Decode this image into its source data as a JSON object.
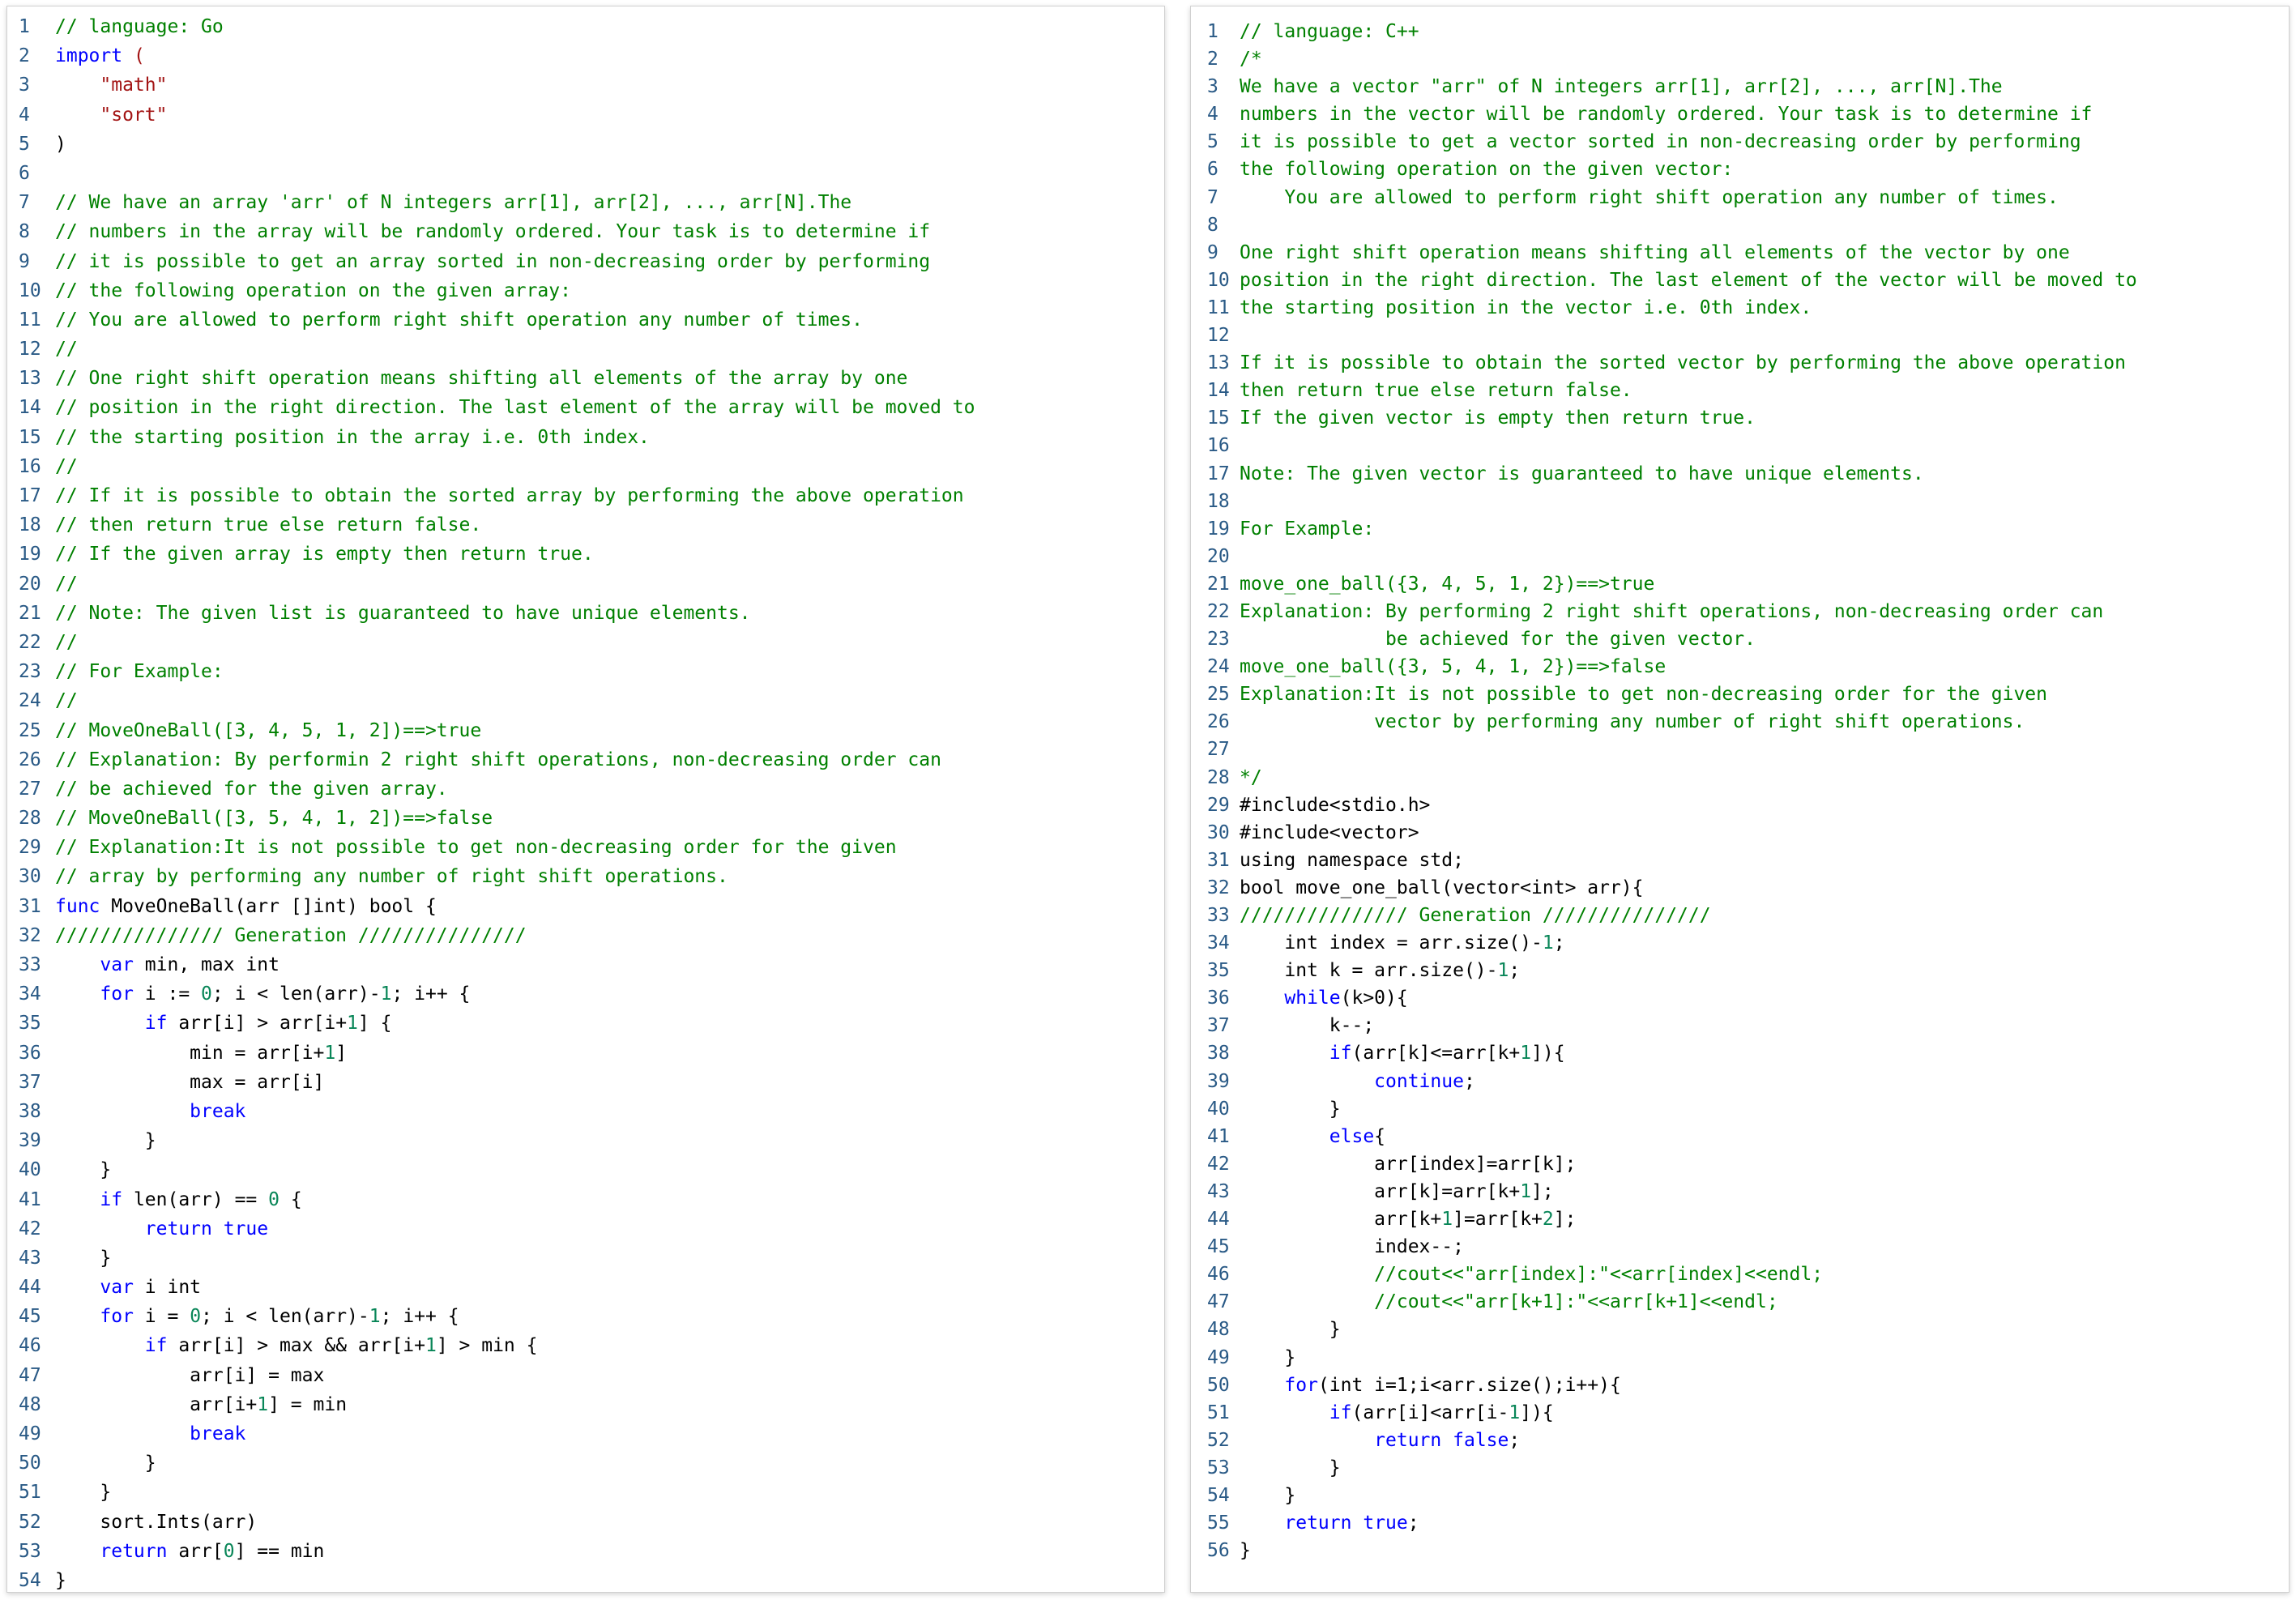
{
  "panels": [
    {
      "id": "left",
      "lines": [
        [
          [
            "c",
            "// language: Go"
          ]
        ],
        [
          [
            "k",
            "import"
          ],
          [
            "t",
            " "
          ],
          [
            "s",
            "("
          ]
        ],
        [
          [
            "t",
            "    "
          ],
          [
            "s",
            "\"math\""
          ]
        ],
        [
          [
            "t",
            "    "
          ],
          [
            "s",
            "\"sort\""
          ]
        ],
        [
          [
            "t",
            ")"
          ]
        ],
        [],
        [
          [
            "c",
            "// We have an array 'arr' of N integers arr[1], arr[2], ..., arr[N].The"
          ]
        ],
        [
          [
            "c",
            "// numbers in the array will be randomly ordered. Your task is to determine if"
          ]
        ],
        [
          [
            "c",
            "// it is possible to get an array sorted in non-decreasing order by performing"
          ]
        ],
        [
          [
            "c",
            "// the following operation on the given array:"
          ]
        ],
        [
          [
            "c",
            "// You are allowed to perform right shift operation any number of times."
          ]
        ],
        [
          [
            "c",
            "//"
          ]
        ],
        [
          [
            "c",
            "// One right shift operation means shifting all elements of the array by one"
          ]
        ],
        [
          [
            "c",
            "// position in the right direction. The last element of the array will be moved to"
          ]
        ],
        [
          [
            "c",
            "// the starting position in the array i.e. 0th index."
          ]
        ],
        [
          [
            "c",
            "//"
          ]
        ],
        [
          [
            "c",
            "// If it is possible to obtain the sorted array by performing the above operation"
          ]
        ],
        [
          [
            "c",
            "// then return true else return false."
          ]
        ],
        [
          [
            "c",
            "// If the given array is empty then return true."
          ]
        ],
        [
          [
            "c",
            "//"
          ]
        ],
        [
          [
            "c",
            "// Note: The given list is guaranteed to have unique elements."
          ]
        ],
        [
          [
            "c",
            "//"
          ]
        ],
        [
          [
            "c",
            "// For Example:"
          ]
        ],
        [
          [
            "c",
            "//"
          ]
        ],
        [
          [
            "c",
            "// MoveOneBall([3, 4, 5, 1, 2])==>true"
          ]
        ],
        [
          [
            "c",
            "// Explanation: By performin 2 right shift operations, non-decreasing order can"
          ]
        ],
        [
          [
            "c",
            "// be achieved for the given array."
          ]
        ],
        [
          [
            "c",
            "// MoveOneBall([3, 5, 4, 1, 2])==>false"
          ]
        ],
        [
          [
            "c",
            "// Explanation:It is not possible to get non-decreasing order for the given"
          ]
        ],
        [
          [
            "c",
            "// array by performing any number of right shift operations."
          ]
        ],
        [
          [
            "k",
            "func"
          ],
          [
            "t",
            " MoveOneBall(arr []int) bool {"
          ]
        ],
        [
          [
            "c",
            "/////////////// Generation ///////////////"
          ]
        ],
        [
          [
            "t",
            "    "
          ],
          [
            "k",
            "var"
          ],
          [
            "t",
            " min, max int"
          ]
        ],
        [
          [
            "t",
            "    "
          ],
          [
            "k",
            "for"
          ],
          [
            "t",
            " i := "
          ],
          [
            "n",
            "0"
          ],
          [
            "t",
            "; i < len(arr)-"
          ],
          [
            "n",
            "1"
          ],
          [
            "t",
            "; i++ {"
          ]
        ],
        [
          [
            "t",
            "        "
          ],
          [
            "k",
            "if"
          ],
          [
            "t",
            " arr[i] > arr[i+"
          ],
          [
            "n",
            "1"
          ],
          [
            "t",
            "] {"
          ]
        ],
        [
          [
            "t",
            "            min = arr[i+"
          ],
          [
            "n",
            "1"
          ],
          [
            "t",
            "]"
          ]
        ],
        [
          [
            "t",
            "            max = arr[i]"
          ]
        ],
        [
          [
            "t",
            "            "
          ],
          [
            "k",
            "break"
          ]
        ],
        [
          [
            "t",
            "        }"
          ]
        ],
        [
          [
            "t",
            "    }"
          ]
        ],
        [
          [
            "t",
            "    "
          ],
          [
            "k",
            "if"
          ],
          [
            "t",
            " len(arr) == "
          ],
          [
            "n",
            "0"
          ],
          [
            "t",
            " {"
          ]
        ],
        [
          [
            "t",
            "        "
          ],
          [
            "k",
            "return"
          ],
          [
            "t",
            " "
          ],
          [
            "k",
            "true"
          ]
        ],
        [
          [
            "t",
            "    }"
          ]
        ],
        [
          [
            "t",
            "    "
          ],
          [
            "k",
            "var"
          ],
          [
            "t",
            " i int"
          ]
        ],
        [
          [
            "t",
            "    "
          ],
          [
            "k",
            "for"
          ],
          [
            "t",
            " i = "
          ],
          [
            "n",
            "0"
          ],
          [
            "t",
            "; i < len(arr)-"
          ],
          [
            "n",
            "1"
          ],
          [
            "t",
            "; i++ {"
          ]
        ],
        [
          [
            "t",
            "        "
          ],
          [
            "k",
            "if"
          ],
          [
            "t",
            " arr[i] > max && arr[i+"
          ],
          [
            "n",
            "1"
          ],
          [
            "t",
            "] > min {"
          ]
        ],
        [
          [
            "t",
            "            arr[i] = max"
          ]
        ],
        [
          [
            "t",
            "            arr[i+"
          ],
          [
            "n",
            "1"
          ],
          [
            "t",
            "] = min"
          ]
        ],
        [
          [
            "t",
            "            "
          ],
          [
            "k",
            "break"
          ]
        ],
        [
          [
            "t",
            "        }"
          ]
        ],
        [
          [
            "t",
            "    }"
          ]
        ],
        [
          [
            "t",
            "    sort.Ints(arr)"
          ]
        ],
        [
          [
            "t",
            "    "
          ],
          [
            "k",
            "return"
          ],
          [
            "t",
            " arr["
          ],
          [
            "n",
            "0"
          ],
          [
            "t",
            "] == min"
          ]
        ],
        [
          [
            "t",
            "}"
          ]
        ]
      ]
    },
    {
      "id": "right",
      "lines": [
        [
          [
            "c",
            "// language: C++"
          ]
        ],
        [
          [
            "c",
            "/*"
          ]
        ],
        [
          [
            "c",
            "We have a vector \"arr\" of N integers arr[1], arr[2], ..., arr[N].The"
          ]
        ],
        [
          [
            "c",
            "numbers in the vector will be randomly ordered. Your task is to determine if"
          ]
        ],
        [
          [
            "c",
            "it is possible to get a vector sorted in non-decreasing order by performing"
          ]
        ],
        [
          [
            "c",
            "the following operation on the given vector:"
          ]
        ],
        [
          [
            "c",
            "    You are allowed to perform right shift operation any number of times."
          ]
        ],
        [],
        [
          [
            "c",
            "One right shift operation means shifting all elements of the vector by one"
          ]
        ],
        [
          [
            "c",
            "position in the right direction. The last element of the vector will be moved to"
          ]
        ],
        [
          [
            "c",
            "the starting position in the vector i.e. 0th index."
          ]
        ],
        [],
        [
          [
            "c",
            "If it is possible to obtain the sorted vector by performing the above operation"
          ]
        ],
        [
          [
            "c",
            "then return true else return false."
          ]
        ],
        [
          [
            "c",
            "If the given vector is empty then return true."
          ]
        ],
        [],
        [
          [
            "c",
            "Note: The given vector is guaranteed to have unique elements."
          ]
        ],
        [],
        [
          [
            "c",
            "For Example:"
          ]
        ],
        [],
        [
          [
            "c",
            "move_one_ball({3, 4, 5, 1, 2})==>true"
          ]
        ],
        [
          [
            "c",
            "Explanation: By performing 2 right shift operations, non-decreasing order can"
          ]
        ],
        [
          [
            "c",
            "             be achieved for the given vector."
          ]
        ],
        [
          [
            "c",
            "move_one_ball({3, 5, 4, 1, 2})==>false"
          ]
        ],
        [
          [
            "c",
            "Explanation:It is not possible to get non-decreasing order for the given"
          ]
        ],
        [
          [
            "c",
            "            vector by performing any number of right shift operations."
          ]
        ],
        [],
        [
          [
            "c",
            "*/"
          ]
        ],
        [
          [
            "t",
            "#include<stdio.h>"
          ]
        ],
        [
          [
            "t",
            "#include<vector>"
          ]
        ],
        [
          [
            "t",
            "using namespace std;"
          ]
        ],
        [
          [
            "t",
            "bool move_one_ball(vector<int> arr){"
          ]
        ],
        [
          [
            "c",
            "/////////////// Generation ///////////////"
          ]
        ],
        [
          [
            "t",
            "    int index = arr.size()-"
          ],
          [
            "n",
            "1"
          ],
          [
            "t",
            ";"
          ]
        ],
        [
          [
            "t",
            "    int k = arr.size()-"
          ],
          [
            "n",
            "1"
          ],
          [
            "t",
            ";"
          ]
        ],
        [
          [
            "t",
            "    "
          ],
          [
            "k",
            "while"
          ],
          [
            "t",
            "(k>0){"
          ]
        ],
        [
          [
            "t",
            "        k--;"
          ]
        ],
        [
          [
            "t",
            "        "
          ],
          [
            "k",
            "if"
          ],
          [
            "t",
            "(arr[k]<=arr[k+"
          ],
          [
            "n",
            "1"
          ],
          [
            "t",
            "]){"
          ]
        ],
        [
          [
            "t",
            "            "
          ],
          [
            "k",
            "continue"
          ],
          [
            "t",
            ";"
          ]
        ],
        [
          [
            "t",
            "        }"
          ]
        ],
        [
          [
            "t",
            "        "
          ],
          [
            "k",
            "else"
          ],
          [
            "t",
            "{"
          ]
        ],
        [
          [
            "t",
            "            arr[index]=arr[k];"
          ]
        ],
        [
          [
            "t",
            "            arr[k]=arr[k+"
          ],
          [
            "n",
            "1"
          ],
          [
            "t",
            "];"
          ]
        ],
        [
          [
            "t",
            "            arr[k+"
          ],
          [
            "n",
            "1"
          ],
          [
            "t",
            "]=arr[k+"
          ],
          [
            "n",
            "2"
          ],
          [
            "t",
            "];"
          ]
        ],
        [
          [
            "t",
            "            index--;"
          ]
        ],
        [
          [
            "t",
            "            "
          ],
          [
            "c",
            "//cout<<\"arr[index]:\"<<arr[index]<<endl;"
          ]
        ],
        [
          [
            "t",
            "            "
          ],
          [
            "c",
            "//cout<<\"arr[k+1]:\"<<arr[k+1]<<endl;"
          ]
        ],
        [
          [
            "t",
            "        }"
          ]
        ],
        [
          [
            "t",
            "    }"
          ]
        ],
        [
          [
            "t",
            "    "
          ],
          [
            "k",
            "for"
          ],
          [
            "t",
            "(int i=1;i<arr.size();i++){"
          ]
        ],
        [
          [
            "t",
            "        "
          ],
          [
            "k",
            "if"
          ],
          [
            "t",
            "(arr[i]<arr[i-"
          ],
          [
            "n",
            "1"
          ],
          [
            "t",
            "]){"
          ]
        ],
        [
          [
            "t",
            "            "
          ],
          [
            "k",
            "return"
          ],
          [
            "t",
            " "
          ],
          [
            "k",
            "false"
          ],
          [
            "t",
            ";"
          ]
        ],
        [
          [
            "t",
            "        }"
          ]
        ],
        [
          [
            "t",
            "    }"
          ]
        ],
        [
          [
            "t",
            "    "
          ],
          [
            "k",
            "return"
          ],
          [
            "t",
            " "
          ],
          [
            "k",
            "true"
          ],
          [
            "t",
            ";"
          ]
        ],
        [
          [
            "t",
            "}"
          ]
        ]
      ]
    }
  ]
}
